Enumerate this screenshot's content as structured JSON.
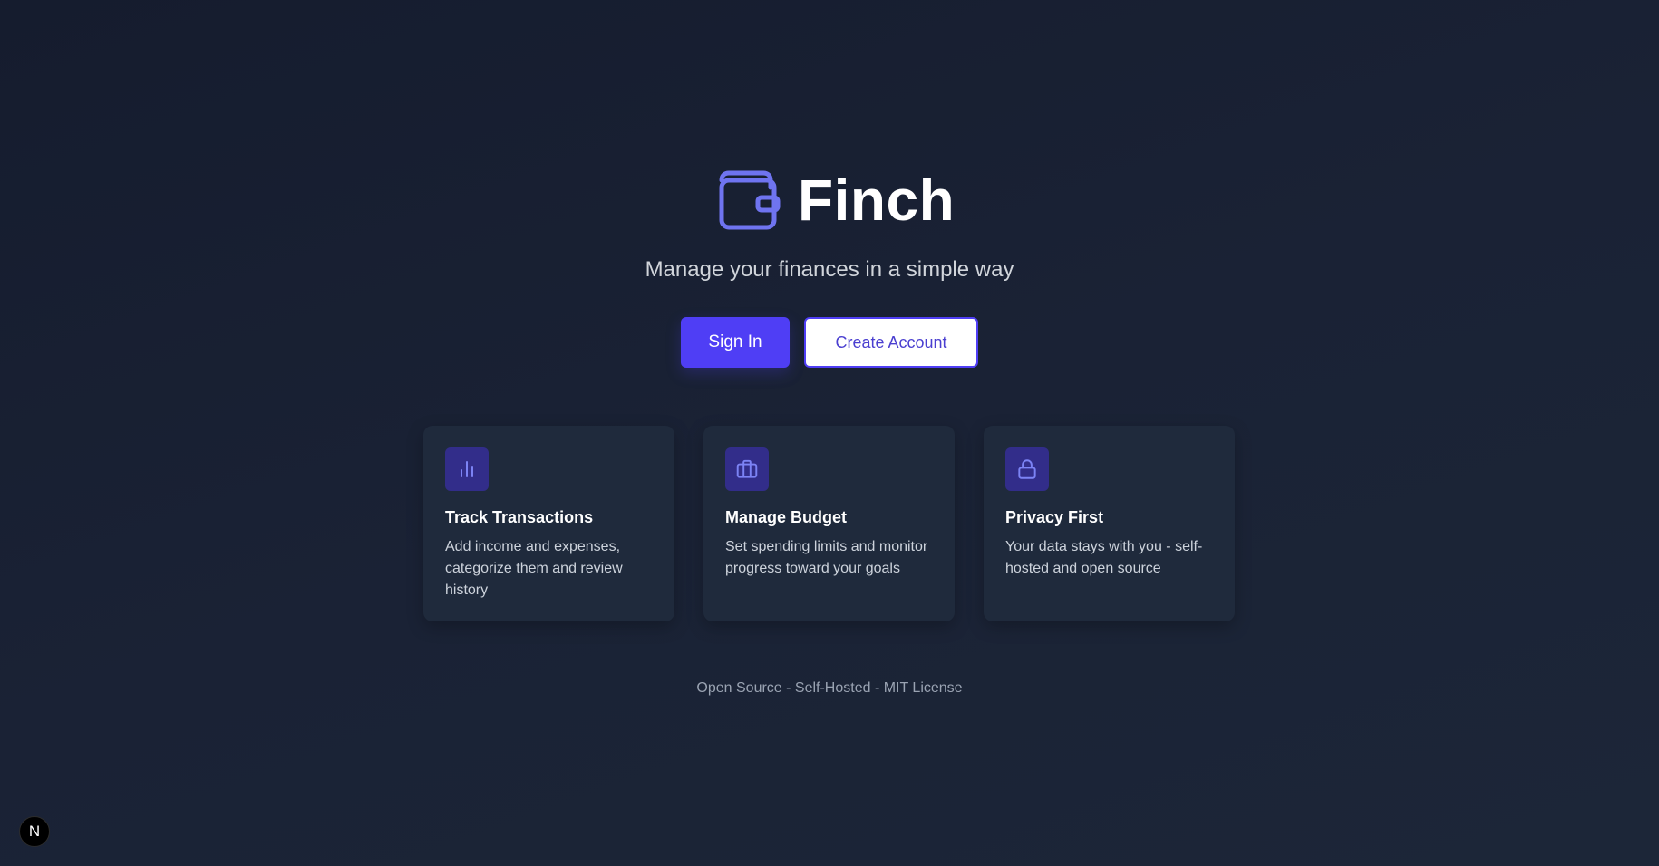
{
  "app": {
    "name": "Finch",
    "tagline": "Manage your finances in a simple way"
  },
  "actions": {
    "sign_in_label": "Sign In",
    "create_account_label": "Create Account"
  },
  "features": [
    {
      "icon": "bar-chart-icon",
      "title": "Track Transactions",
      "description": "Add income and expenses, categorize them and review history"
    },
    {
      "icon": "briefcase-icon",
      "title": "Manage Budget",
      "description": "Set spending limits and monitor progress toward your goals"
    },
    {
      "icon": "lock-icon",
      "title": "Privacy First",
      "description": "Your data stays with you - self-hosted and open source"
    }
  ],
  "footer": {
    "note": "Open Source - Self-Hosted - MIT License"
  },
  "dev_indicator": {
    "label": "N"
  },
  "colors": {
    "accent": "#4f3ef5",
    "logo": "#6f74f0",
    "background": "#172033",
    "card": "#1f2a3c",
    "icon_tile": "#322d8a"
  }
}
